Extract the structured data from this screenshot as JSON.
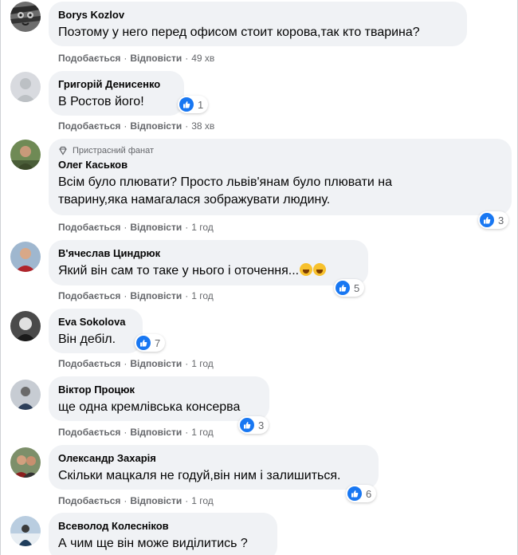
{
  "labels": {
    "like": "Подобається",
    "reply": "Відповісти",
    "separator": "·"
  },
  "colors": {
    "bubble": "#f0f2f5",
    "meta": "#65676b",
    "like_blue": "#1877f2"
  },
  "comments": [
    {
      "author": "Borys Kozlov",
      "text": "Поэтому у него перед офисом стоит корова,так кто тварина?",
      "time": "49 хв",
      "reactions": "",
      "avatar_icon": "tiger-avatar"
    },
    {
      "author": "Григорій Денисенко",
      "text": "В Ростов його!",
      "time": "38 хв",
      "reactions": "1",
      "avatar_icon": "default-avatar"
    },
    {
      "author": "Олег Каськов",
      "badge": "Пристрасний фанат",
      "text_lines": [
        "Всім було плювати? Просто львів'янам було плювати на",
        "тварину,яка намагалася зображувати людину."
      ],
      "time": "1 год",
      "reactions": "3",
      "avatar_icon": "photo-avatar"
    },
    {
      "author": "В'ячеслав Циндрюк",
      "text": "Який він сам то таке у нього і оточення...",
      "time": "1 год",
      "reactions": "5",
      "avatar_icon": "photo-avatar"
    },
    {
      "author": "Eva Sokolova",
      "text": "Він дебіл.",
      "time": "1 год",
      "reactions": "7",
      "avatar_icon": "photo-avatar"
    },
    {
      "author": "Віктор Процюк",
      "text": "ще одна кремлівська консерва",
      "time": "1 год",
      "reactions": "3",
      "avatar_icon": "photo-avatar"
    },
    {
      "author": "Олександр Захарія",
      "text": "Скільки мацкаля не годуй,він ним і залишиться.",
      "time": "1 год",
      "reactions": "6",
      "avatar_icon": "photo-avatar"
    },
    {
      "author": "Всеволод Колесніков",
      "text": "А чим ще він може виділитись ?",
      "time": "",
      "reactions": "",
      "avatar_icon": "photo-avatar"
    }
  ]
}
